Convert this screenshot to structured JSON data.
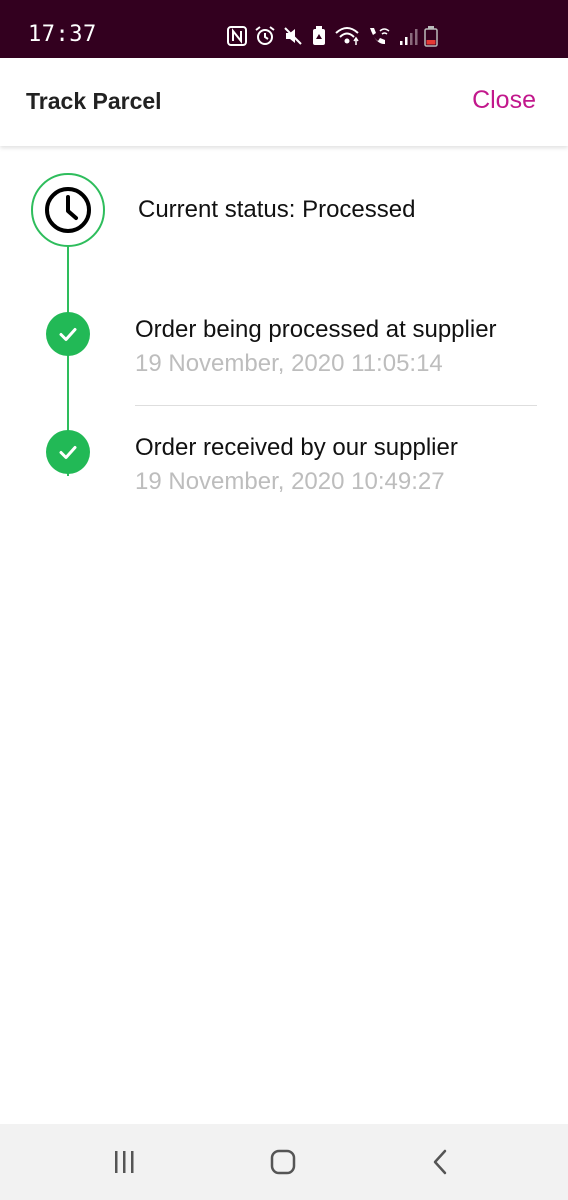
{
  "status_bar": {
    "time": "17:37",
    "icons": [
      "nfc-icon",
      "alarm-icon",
      "mute-icon",
      "battery-saver-icon",
      "wifi-icon",
      "wifi-calling-icon",
      "signal-icon",
      "battery-low-icon"
    ]
  },
  "header": {
    "title": "Track Parcel",
    "close_label": "Close"
  },
  "tracking": {
    "current_status": "Current status: Processed",
    "events": [
      {
        "title": "Order being processed at supplier",
        "timestamp": "19 November, 2020 11:05:14"
      },
      {
        "title": "Order received by our supplier",
        "timestamp": "19 November, 2020 10:49:27"
      }
    ]
  },
  "colors": {
    "status_bar_bg": "#33001f",
    "accent": "#c2188c",
    "timeline_green": "#2ebd5c",
    "timestamp_gray": "#bdbdbd"
  },
  "nav_bar": {
    "buttons": [
      "recents-icon",
      "home-icon",
      "back-icon"
    ]
  }
}
